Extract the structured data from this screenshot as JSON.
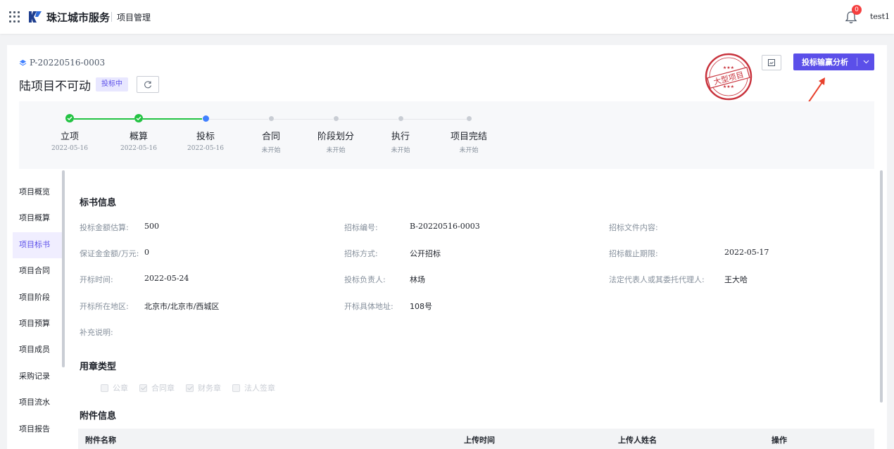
{
  "topbar": {
    "brand": "珠江城市服务",
    "module": "项目管理",
    "notification_count": "0",
    "username": "test1"
  },
  "project": {
    "code": "P-20220516-0003",
    "title": "陆项目不可动",
    "status": "投标中",
    "stamp_text": "大型项目",
    "primary_action": "投标输赢分析"
  },
  "steps": [
    {
      "name": "立项",
      "date": "2022-05-16",
      "state": "done"
    },
    {
      "name": "概算",
      "date": "2022-05-16",
      "state": "done"
    },
    {
      "name": "投标",
      "date": "2022-05-16",
      "state": "active"
    },
    {
      "name": "合同",
      "date": "未开始",
      "state": "pending"
    },
    {
      "name": "阶段划分",
      "date": "未开始",
      "state": "pending"
    },
    {
      "name": "执行",
      "date": "未开始",
      "state": "pending"
    },
    {
      "name": "项目完结",
      "date": "未开始",
      "state": "pending"
    }
  ],
  "nav": [
    "项目概览",
    "项目概算",
    "项目标书",
    "项目合同",
    "项目阶段",
    "项目预算",
    "项目成员",
    "采购记录",
    "项目流水",
    "项目报告"
  ],
  "nav_active": "项目标书",
  "bid_info": {
    "title": "标书信息",
    "fields": {
      "amount_label": "投标金额估算:",
      "amount": "500",
      "bid_no_label": "招标编号:",
      "bid_no": "B-20220516-0003",
      "doc_label": "招标文件内容:",
      "doc": "",
      "deposit_label": "保证金金额/万元:",
      "deposit": "0",
      "method_label": "招标方式:",
      "method": "公开招标",
      "deadline_label": "招标截止期限:",
      "deadline": "2022-05-17",
      "open_time_label": "开标时间:",
      "open_time": "2022-05-24",
      "owner_label": "投标负责人:",
      "owner": "林场",
      "rep_label": "法定代表人或其委托代理人:",
      "rep": "王大哈",
      "region_label": "开标所在地区:",
      "region": "北京市/北京市/西城区",
      "address_label": "开标具体地址:",
      "address": "108号",
      "note_label": "补充说明:",
      "note": ""
    }
  },
  "seal": {
    "title": "用章类型",
    "options": [
      {
        "label": "公章",
        "checked": false
      },
      {
        "label": "合同章",
        "checked": true
      },
      {
        "label": "财务章",
        "checked": true
      },
      {
        "label": "法人签章",
        "checked": false
      }
    ]
  },
  "attachments": {
    "title": "附件信息",
    "columns": [
      "附件名称",
      "上传时间",
      "上传人姓名",
      "操作"
    ]
  },
  "colors": {
    "primary": "#5b4fe9",
    "done": "#23c343",
    "active": "#4080ff",
    "stamp": "#c8323c"
  }
}
